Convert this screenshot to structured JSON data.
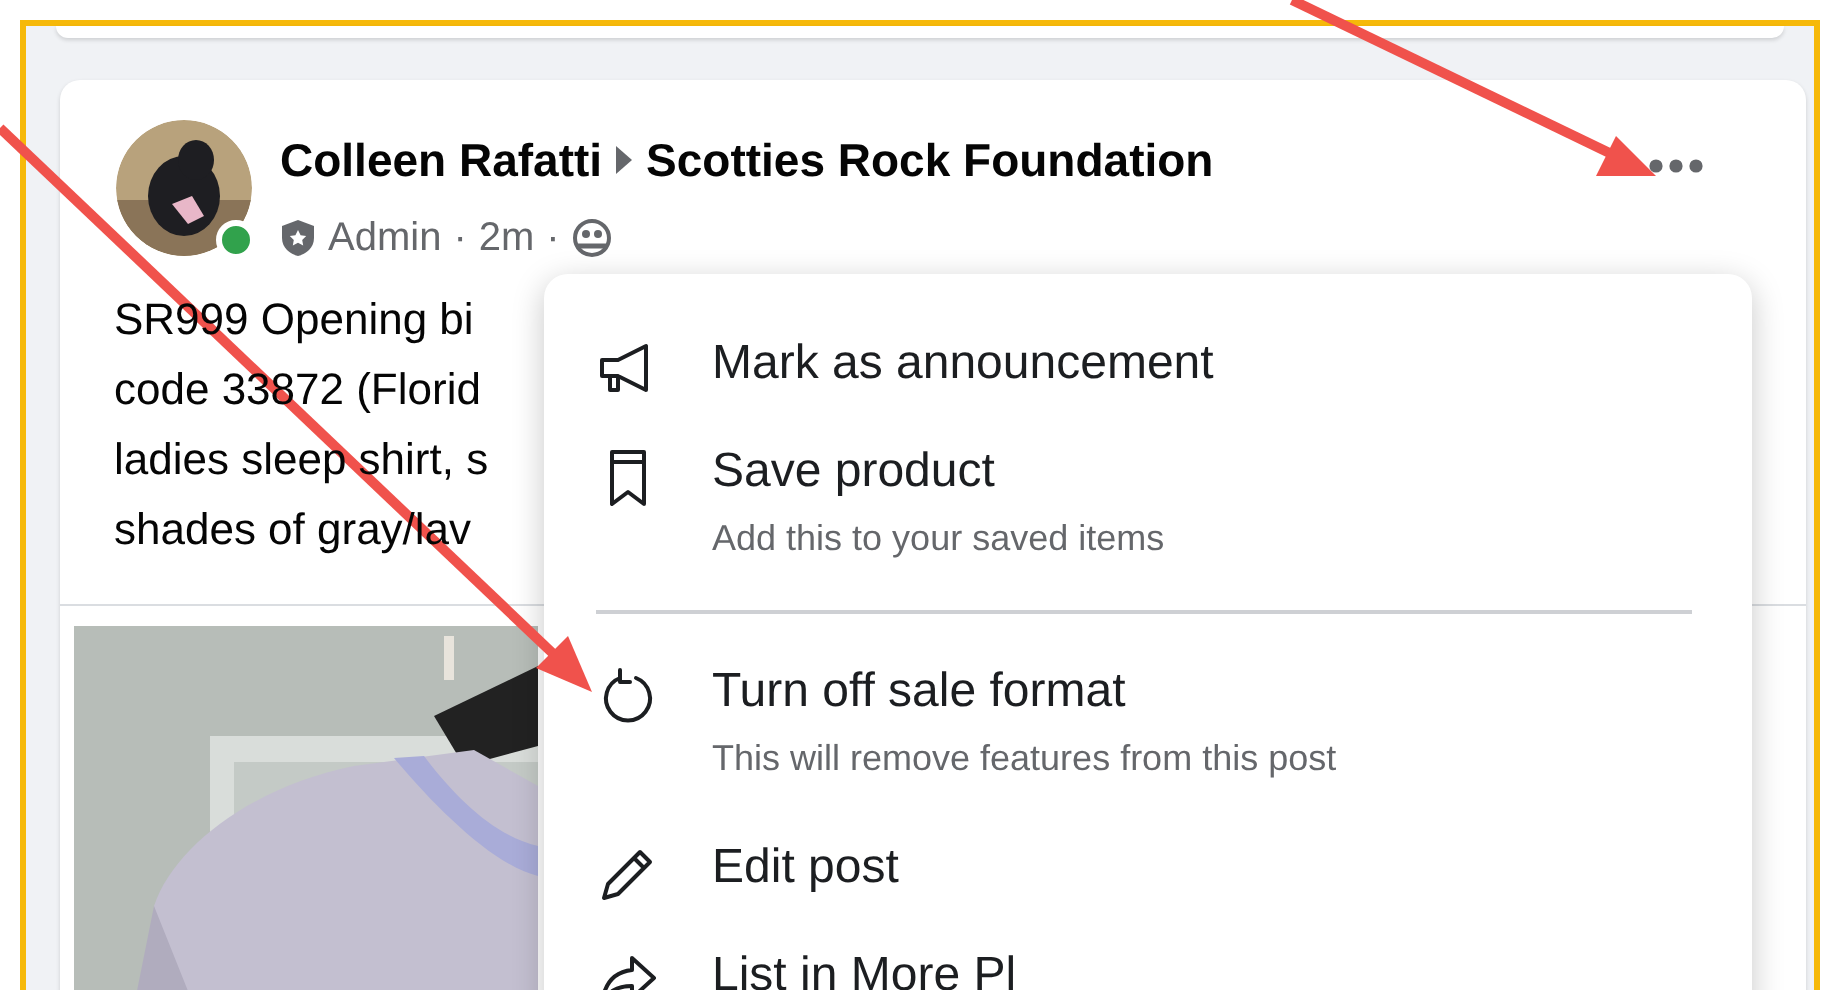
{
  "post": {
    "author": "Colleen Rafatti",
    "group": "Scotties Rock Foundation",
    "online": true,
    "role": "Admin",
    "separator_1": "·",
    "time": "2m",
    "separator_2": "·",
    "text_lines": [
      "SR999  Opening bi",
      "code 33872 (Florid",
      "ladies sleep shirt, s",
      "shades of gray/lav"
    ]
  },
  "menu": {
    "items": [
      {
        "kind": "announcement",
        "label": "Mark as announcement"
      },
      {
        "kind": "save",
        "label": "Save product",
        "description": "Add this to your saved items"
      },
      {
        "kind": "divider"
      },
      {
        "kind": "turn-off",
        "label": "Turn off sale format",
        "description": "This will remove features from this post"
      },
      {
        "kind": "edit",
        "label": "Edit post"
      },
      {
        "kind": "share",
        "label": "List in More Pl"
      }
    ]
  }
}
